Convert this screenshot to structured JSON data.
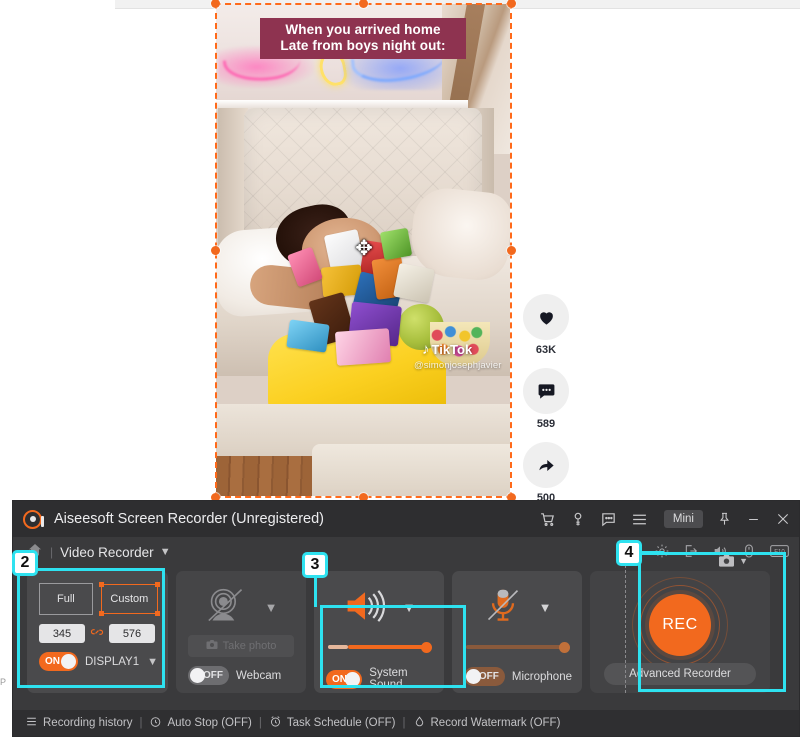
{
  "app": {
    "title": "Aiseesoft Screen Recorder (Unregistered)",
    "logo_icon": "record-dot-icon",
    "titlebar_icons": [
      {
        "name": "cart-icon",
        "glyph": "\u0001"
      },
      {
        "name": "key-icon",
        "glyph": "\u0001"
      },
      {
        "name": "feedback-icon",
        "glyph": "\u0001"
      },
      {
        "name": "menu-icon",
        "glyph": "\u0001"
      }
    ],
    "mini_label": "Mini",
    "pin_icon": "pin-icon",
    "minimize_icon": "minimize-icon",
    "close_icon": "close-icon"
  },
  "toolbar": {
    "home_icon": "home-icon",
    "separator": "|",
    "mode_label": "Video Recorder",
    "dropdown_icon": "chevron-down-icon",
    "right_icons": [
      {
        "name": "settings-gear-icon"
      },
      {
        "name": "export-icon"
      },
      {
        "name": "speaker-icon"
      },
      {
        "name": "mouse-icon"
      },
      {
        "name": "hotkey-f10-icon",
        "label": "F10"
      }
    ]
  },
  "capture_area": {
    "full_label": "Full",
    "custom_label": "Custom",
    "width_value": "345",
    "height_value": "576",
    "link_icon": "link-ratio-icon",
    "toggle_state": "ON",
    "display_label": "DISPLAY1",
    "display_chevron": "chevron-down-icon"
  },
  "webcam": {
    "icon": "webcam-disabled-icon",
    "chevron": "chevron-down-icon",
    "take_photo_label": "Take photo",
    "camera_icon": "camera-icon",
    "toggle_state": "OFF",
    "label": "Webcam"
  },
  "system_sound": {
    "icon": "speaker-on-icon",
    "chevron": "chevron-down-icon",
    "volume_percent": 100,
    "toggle_state": "ON",
    "label": "System Sound"
  },
  "microphone": {
    "icon": "microphone-muted-icon",
    "chevron": "chevron-down-icon",
    "volume_percent": 100,
    "toggle_state": "OFF",
    "label": "Microphone"
  },
  "record": {
    "rec_label": "REC",
    "advanced_label": "Advanced Recorder",
    "snapshot_icon": "camera-snapshot-icon",
    "snapshot_chevron": "chevron-down-icon"
  },
  "statusbar": {
    "items": [
      {
        "icon": "list-icon",
        "label": "Recording history"
      },
      {
        "icon": "clock-icon",
        "label": "Auto Stop (OFF)"
      },
      {
        "icon": "schedule-clock-icon",
        "label": "Task Schedule (OFF)"
      },
      {
        "icon": "watermark-drop-icon",
        "label": "Record Watermark (OFF)"
      }
    ],
    "separator": "|"
  },
  "video": {
    "caption_line1": "When you arrived home",
    "caption_line2": "Late from boys night out:",
    "watermark_brand": "TikTok",
    "watermark_note_icon": "tiktok-note-icon",
    "watermark_handle": "@simonjosephjavier",
    "move_cursor_icon": "move-cursor-icon",
    "social": [
      {
        "icon": "heart-icon",
        "count": "63K"
      },
      {
        "icon": "comment-icon",
        "count": "589"
      },
      {
        "icon": "share-icon",
        "count": "500"
      }
    ]
  },
  "annotations": {
    "badges": [
      "2",
      "3",
      "4"
    ],
    "accent_color": "#2ee2f0"
  },
  "colors": {
    "accent_orange": "#f2691e",
    "selection_orange": "#ff6a1a",
    "app_bg": "#3a3a3c",
    "card_bg": "#4a4a4c",
    "caption_bg": "#8e3350"
  },
  "misc": {
    "left_edge_glyph": "P"
  }
}
